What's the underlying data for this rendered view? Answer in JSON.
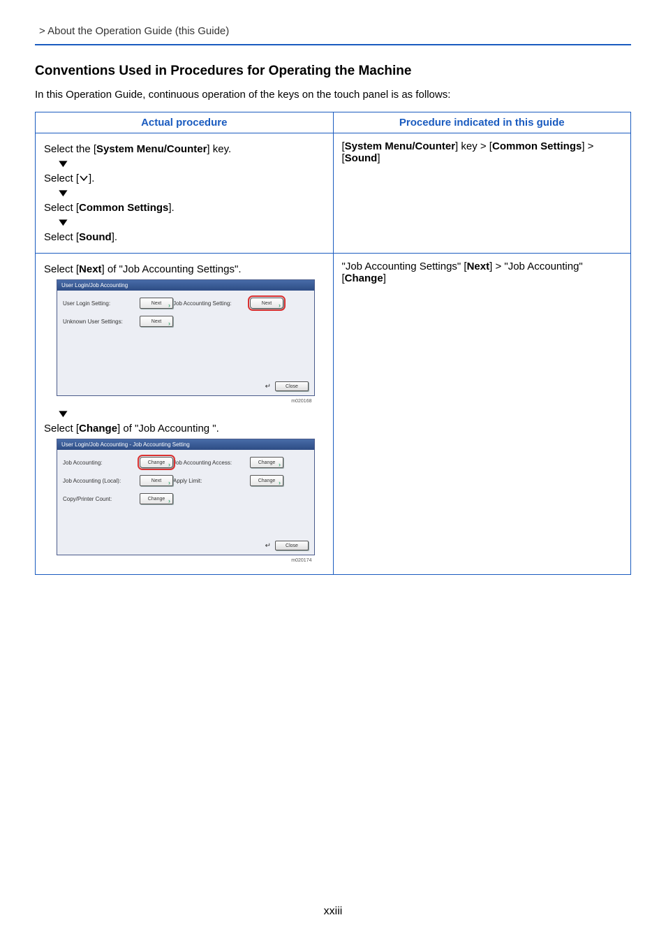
{
  "breadcrumb": " > About the Operation Guide (this Guide)",
  "sectionTitle": "Conventions Used in Procedures for Operating the Machine",
  "intro": "In this Operation Guide, continuous operation of the keys on the touch panel is as follows:",
  "headers": {
    "left": "Actual procedure",
    "right": "Procedure indicated in this guide"
  },
  "row1": {
    "step1_pre": "Select the [",
    "step1_b": "System Menu/Counter",
    "step1_post": "] key.",
    "step2": "Select [",
    "step2_icon_alt": "down-chevron",
    "step2_post": "].",
    "step3_pre": "Select [",
    "step3_b": "Common Settings",
    "step3_post": "].",
    "step4_pre": "Select [",
    "step4_b": "Sound",
    "step4_post": "].",
    "right_pre": "[",
    "right_b1": "System Menu/Counter",
    "right_mid1": "] key > [",
    "right_b2": "Common Settings",
    "right_mid2": "] > [",
    "right_b3": "Sound",
    "right_post": "]"
  },
  "row2": {
    "step1_pre": "Select [",
    "step1_b": "Next",
    "step1_post": "] of \"Job Accounting Settings\".",
    "panel1": {
      "title": "User Login/Job Accounting",
      "r1l": "User Login Setting:",
      "r1b": "Next",
      "r1l2": "Job Accounting Setting:",
      "r1b2": "Next",
      "r2l": "Unknown User Settings:",
      "r2b": "Next",
      "close": "Close",
      "id": "m020168"
    },
    "step2_pre": "Select [",
    "step2_b": "Change",
    "step2_post": "] of \"Job Accounting \".",
    "panel2": {
      "title": "User Login/Job Accounting - Job Accounting Setting",
      "r1l": "Job Accounting:",
      "r1b": "Change",
      "r1l2": "Job Accounting Access:",
      "r1b2": "Change",
      "r2l": "Job Accounting (Local):",
      "r2b": "Next",
      "r2l2": "Apply Limit:",
      "r2b2": "Change",
      "r3l": "Copy/Printer Count:",
      "r3b": "Change",
      "close": "Close",
      "id": "m020174"
    },
    "right_pre": "\"Job Accounting Settings\" [",
    "right_b1": "Next",
    "right_mid": "] > \"Job Accounting\" [",
    "right_b2": "Change",
    "right_post": "]"
  },
  "pageNum": "xxiii"
}
